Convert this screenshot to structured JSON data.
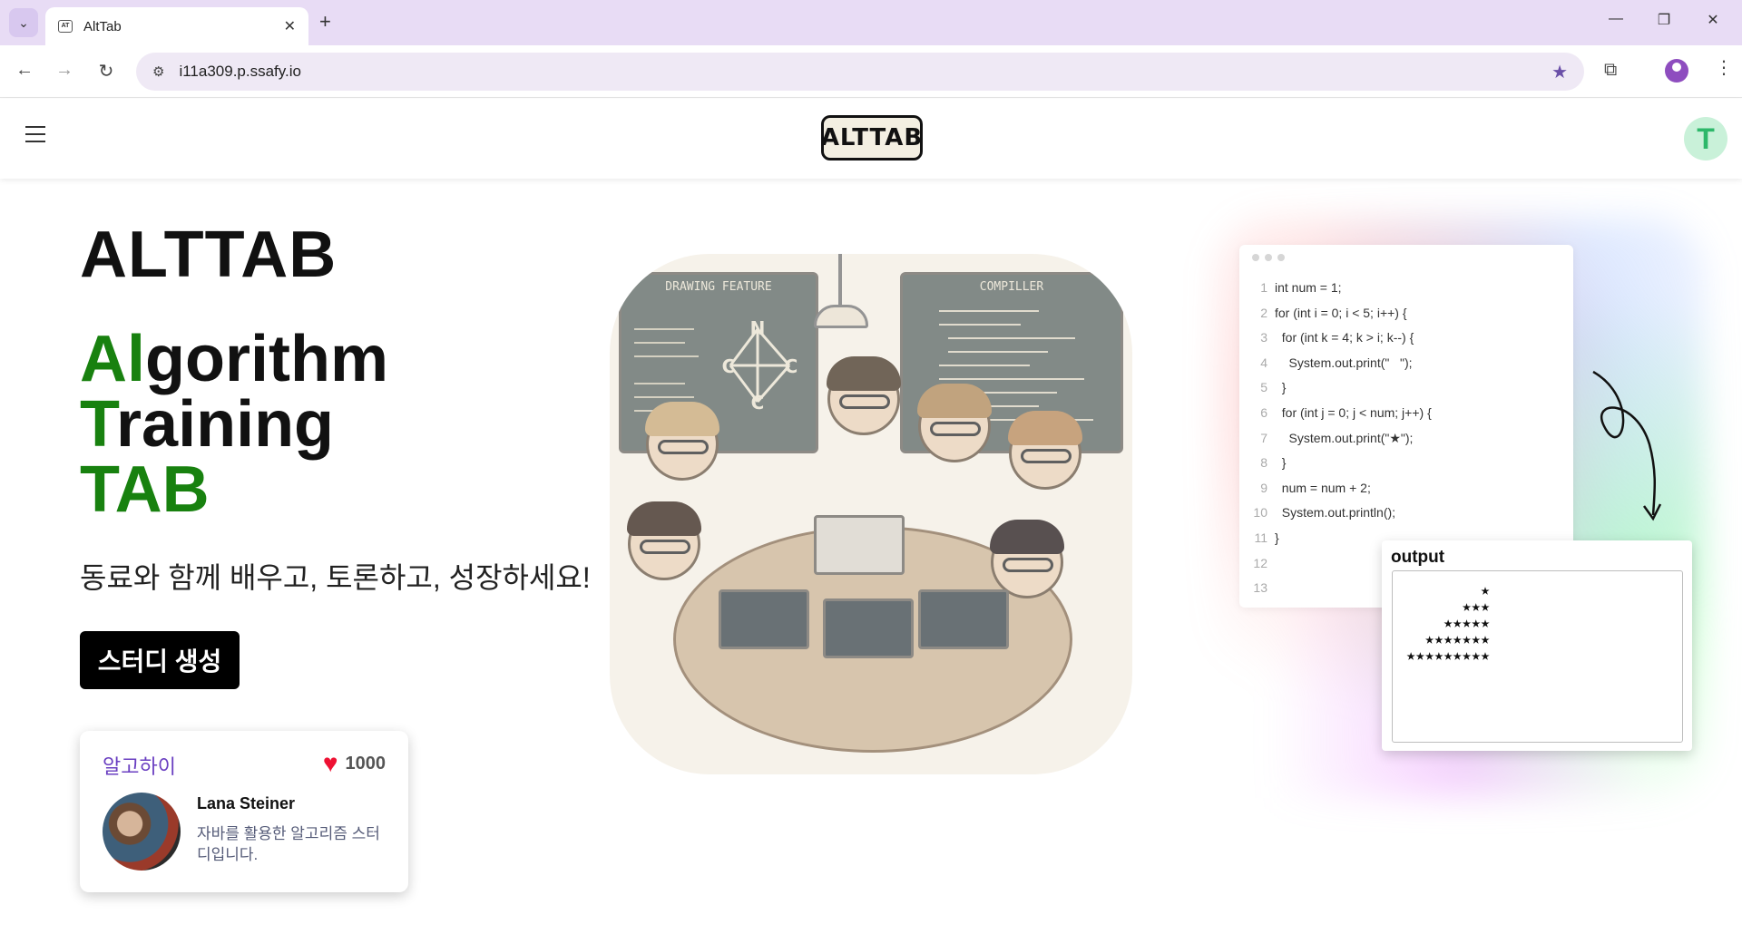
{
  "browser": {
    "tab_title": "AltTab",
    "favicon_text": "AT",
    "url": "i11a309.p.ssafy.io"
  },
  "header": {
    "logo_text": "ALTTAB",
    "avatar_letter": "T"
  },
  "hero": {
    "title": "ALTTAB",
    "acronym": [
      {
        "highlight": "Al",
        "rest": "gorithm"
      },
      {
        "highlight": "T",
        "rest": "raining"
      },
      {
        "highlight": "TAB",
        "rest": ""
      }
    ],
    "tagline": "동료와 함께 배우고, 토론하고, 성장하세요!",
    "create_button": "스터디 생성"
  },
  "study_card": {
    "title": "알고하이",
    "likes": "1000",
    "owner": "Lana Steiner",
    "description": "자바를 활용한 알고리즘 스터디입니다."
  },
  "illustration": {
    "board_left": "DRAWING FEATURE",
    "board_right": "COMPILLER",
    "graph_nodes": [
      "N",
      "C",
      "C",
      "C"
    ]
  },
  "code_panel": {
    "lines": [
      {
        "n": "1",
        "code": "int num = 1;"
      },
      {
        "n": "2",
        "code": "for (int i = 0; i < 5; i++) {"
      },
      {
        "n": "3",
        "code": "  for (int k = 4; k > i; k--) {"
      },
      {
        "n": "4",
        "code": "    System.out.print(\"   \");"
      },
      {
        "n": "5",
        "code": "  }"
      },
      {
        "n": "6",
        "code": "  for (int j = 0; j < num; j++) {"
      },
      {
        "n": "7",
        "code": "    System.out.print(\"★\");"
      },
      {
        "n": "8",
        "code": "  }"
      },
      {
        "n": "9",
        "code": "  num = num + 2;"
      },
      {
        "n": "10",
        "code": "  System.out.println();"
      },
      {
        "n": "11",
        "code": "}"
      },
      {
        "n": "12",
        "code": ""
      },
      {
        "n": "13",
        "code": ""
      }
    ],
    "output_label": "output",
    "output": "        ★\n      ★★★\n    ★★★★★\n  ★★★★★★★\n★★★★★★★★★"
  },
  "colors": {
    "accent_green": "#18810f",
    "card_title_purple": "#6a3fc1",
    "heart_red": "#ee1133"
  }
}
